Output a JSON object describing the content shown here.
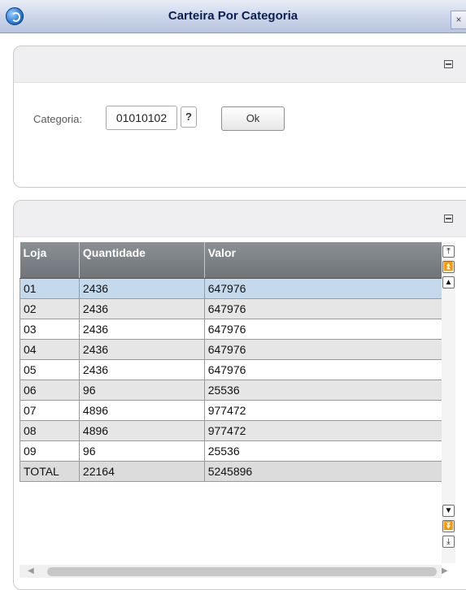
{
  "window": {
    "title": "Carteira Por Categoria",
    "close_label": "×"
  },
  "filter": {
    "category_label": "Categoria:",
    "category_value": "01010102",
    "help_label": "?",
    "ok_label": "Ok"
  },
  "grid": {
    "headers": [
      "Loja",
      "Quantidade",
      "Valor"
    ],
    "rows": [
      [
        "01",
        "2436",
        "647976"
      ],
      [
        "02",
        "2436",
        "647976"
      ],
      [
        "03",
        "2436",
        "647976"
      ],
      [
        "04",
        "2436",
        "647976"
      ],
      [
        "05",
        "2436",
        "647976"
      ],
      [
        "06",
        "96",
        "25536"
      ],
      [
        "07",
        "4896",
        "977472"
      ],
      [
        "08",
        "4896",
        "977472"
      ],
      [
        "09",
        "96",
        "25536"
      ],
      [
        "TOTAL",
        "22164",
        "5245896"
      ]
    ]
  },
  "icons": {
    "app": "app-logo-icon",
    "collapse": "collapse-icon",
    "scroll_top": "scroll-to-top-icon",
    "page_up": "page-up-icon",
    "line_up": "line-up-icon",
    "line_down": "line-down-icon",
    "page_down": "page-down-icon",
    "scroll_bottom": "scroll-to-bottom-icon",
    "left": "scroll-left-icon",
    "right": "scroll-right-icon"
  }
}
